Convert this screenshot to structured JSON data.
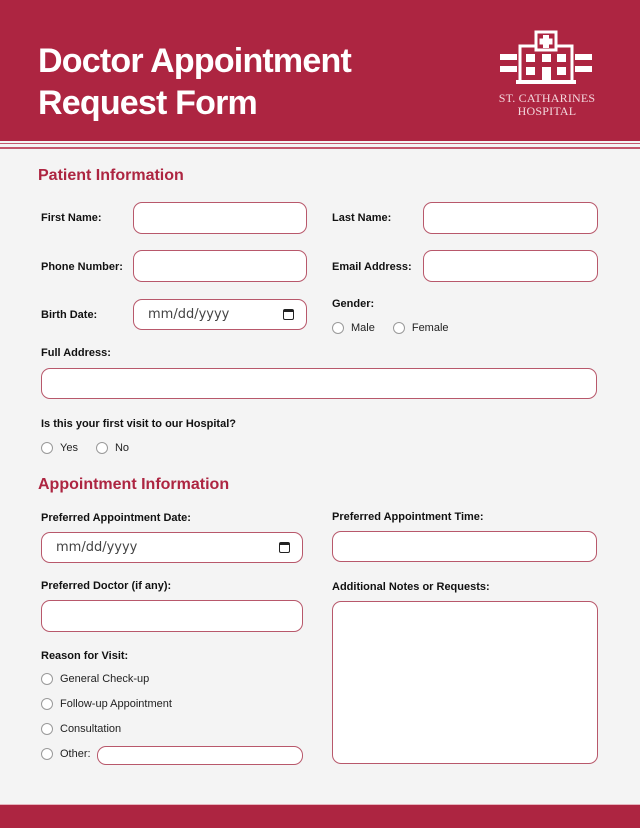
{
  "header": {
    "title_line1": "Doctor Appointment",
    "title_line2": "Request Form",
    "logo_icon": "hospital-building-icon",
    "hospital_name_line1": "ST. CATHARINES",
    "hospital_name_line2": "HOSPITAL"
  },
  "colors": {
    "brand": "#ad2541",
    "field_border": "#b8586b",
    "background": "#f4f4f4"
  },
  "patient": {
    "section_title": "Patient Information",
    "first_name_label": "First Name:",
    "first_name_value": "",
    "last_name_label": "Last Name:",
    "last_name_value": "",
    "phone_label": "Phone Number:",
    "phone_value": "",
    "email_label": "Email Address:",
    "email_value": "",
    "birth_label": "Birth Date:",
    "birth_placeholder": "mm/dd/yyyy",
    "gender_label": "Gender:",
    "gender_options": [
      "Male",
      "Female"
    ],
    "address_label": "Full Address:",
    "address_value": "",
    "first_visit_label": "Is this your first visit to our Hospital?",
    "first_visit_options": [
      "Yes",
      "No"
    ]
  },
  "appointment": {
    "section_title": "Appointment Information",
    "date_label": "Preferred Appointment Date:",
    "date_placeholder": "mm/dd/yyyy",
    "time_label": "Preferred Appointment Time:",
    "time_value": "",
    "doctor_label": "Preferred Doctor (if any):",
    "doctor_value": "",
    "notes_label": "Additional Notes or Requests:",
    "notes_value": "",
    "reason_label": "Reason for Visit:",
    "reason_options": [
      "General Check-up",
      "Follow-up Appointment",
      "Consultation",
      "Other:"
    ],
    "other_value": ""
  }
}
